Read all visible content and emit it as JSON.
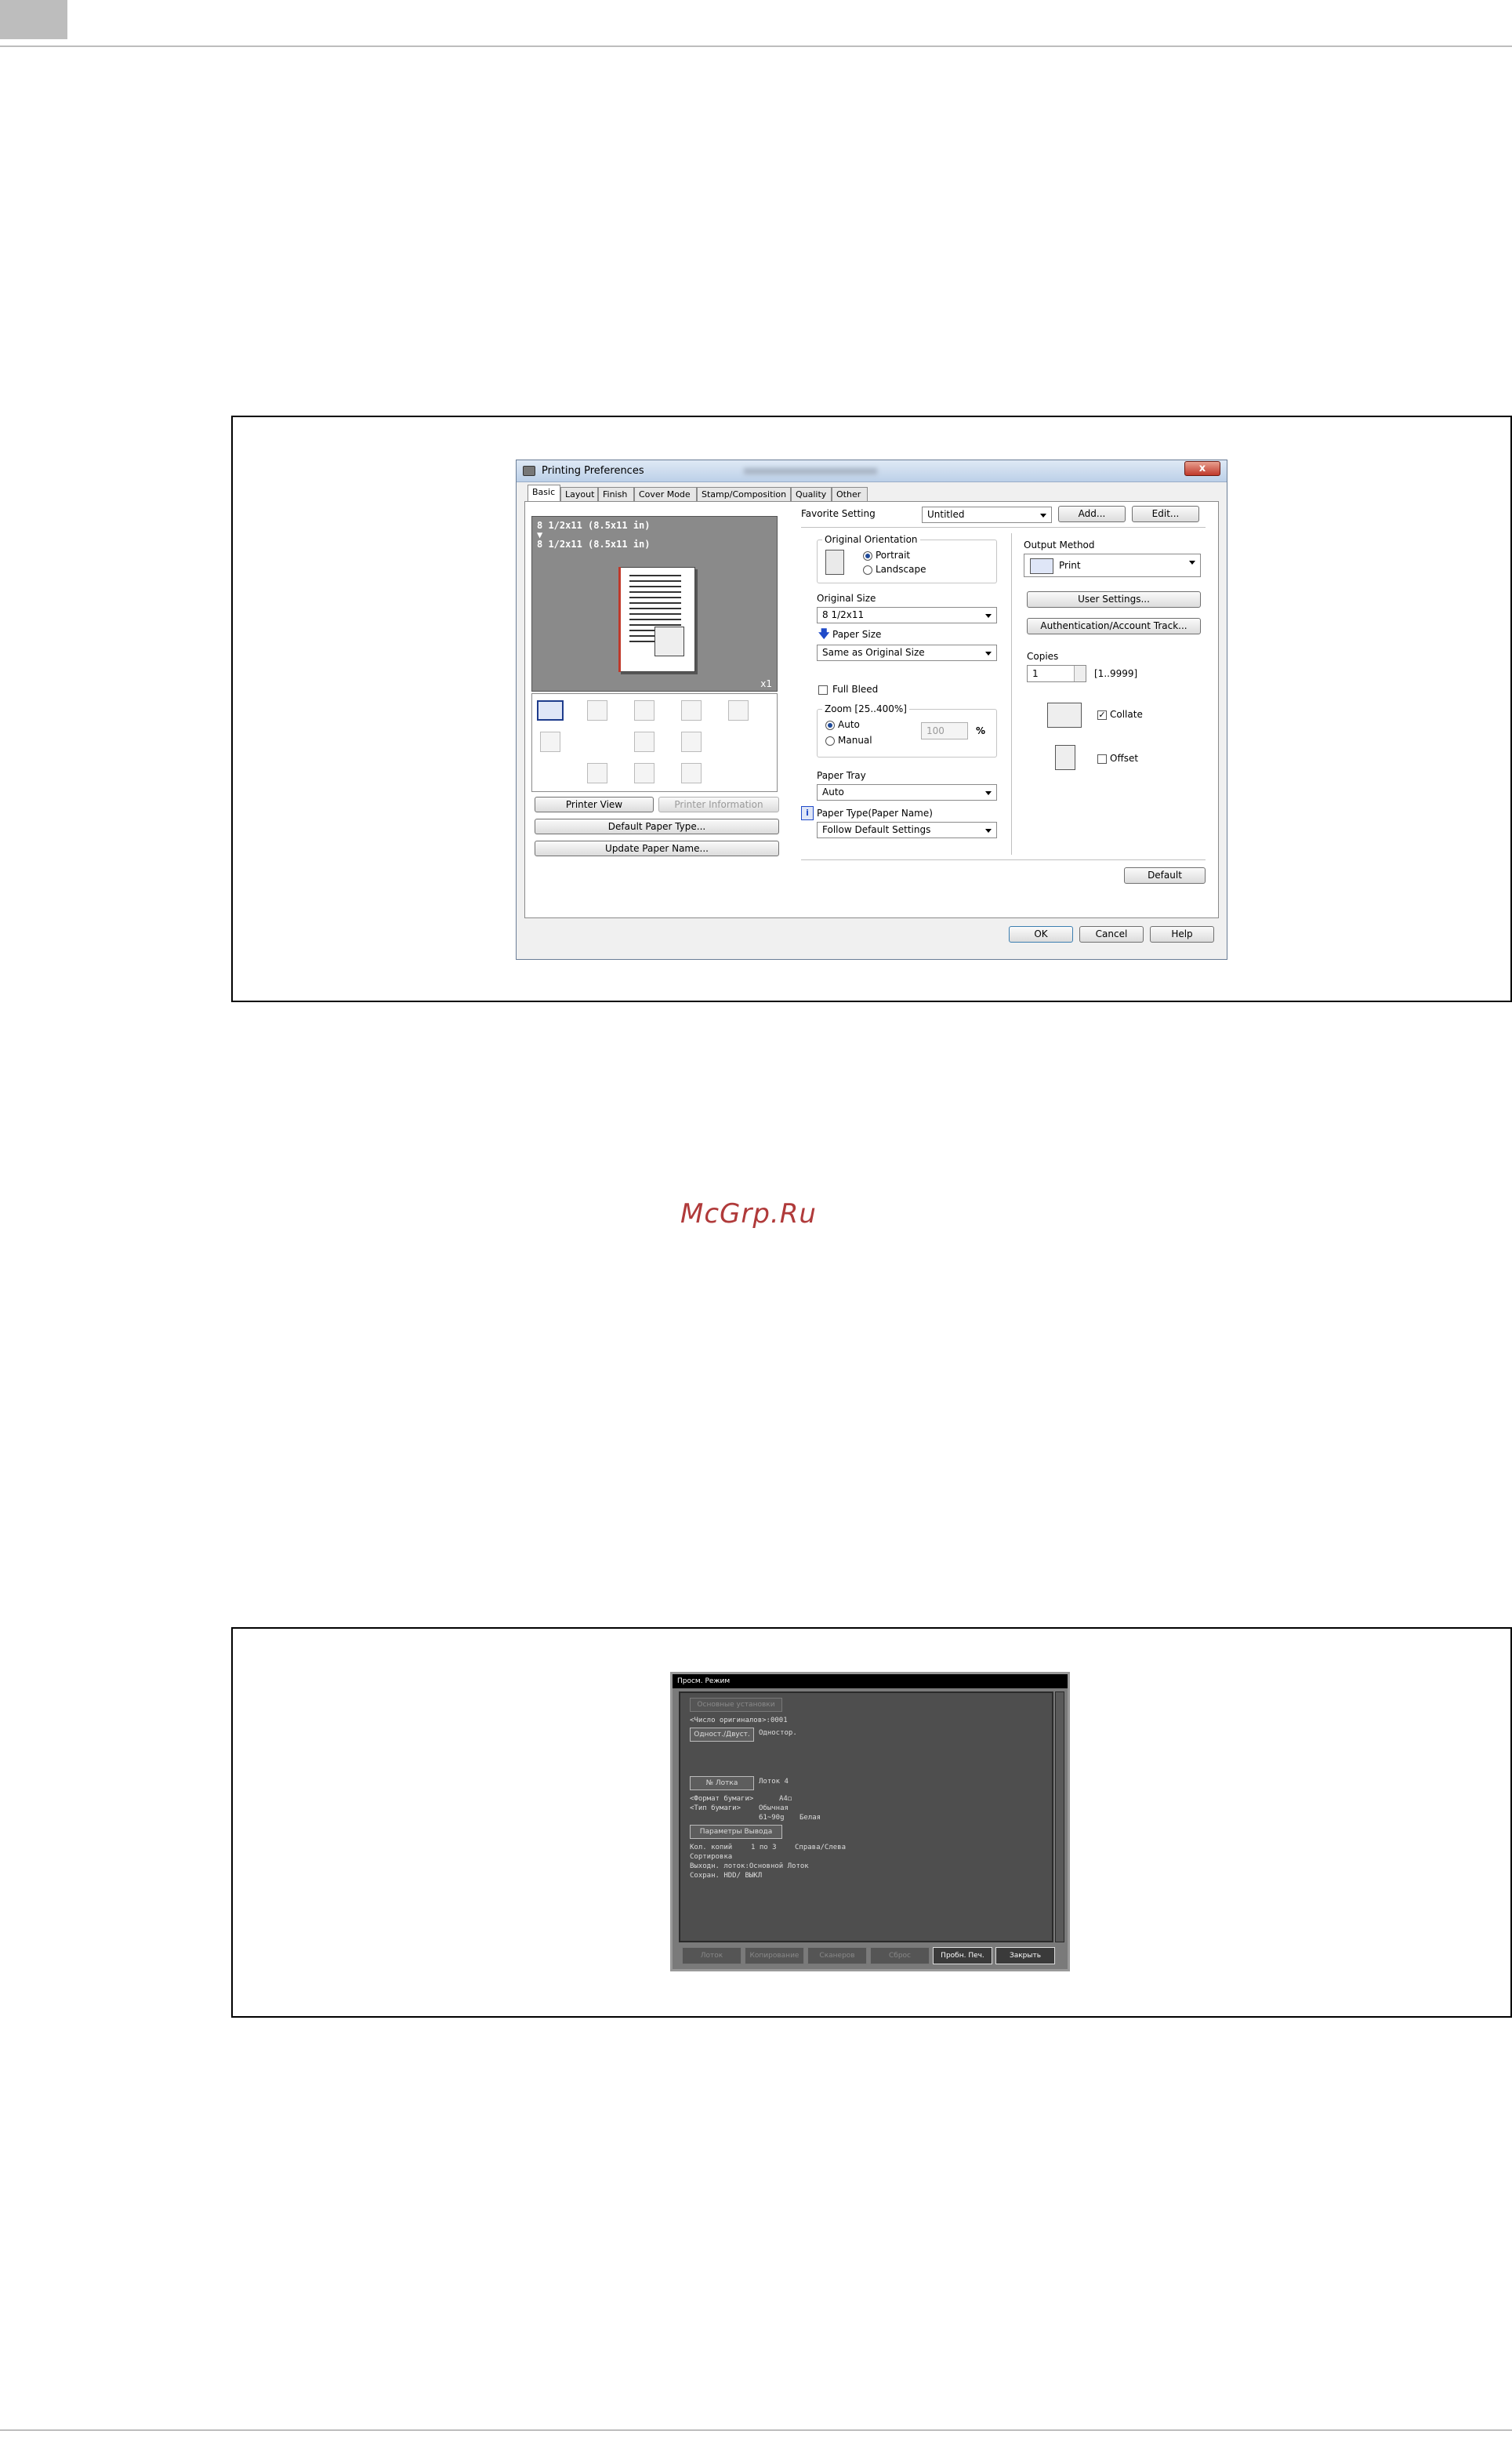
{
  "watermark": "McGrp.Ru",
  "dialog": {
    "title": "Printing Preferences",
    "close_label": "x",
    "tabs": [
      "Basic",
      "Layout",
      "Finish",
      "Cover Mode",
      "Stamp/Composition",
      "Quality",
      "Other"
    ],
    "active_tab": "Basic",
    "preview": {
      "line1": "8 1/2x11 (8.5x11 in)",
      "arrow": "▼",
      "line2": "8 1/2x11 (8.5x11 in)",
      "copies_badge": "x1"
    },
    "left_buttons": {
      "printer_view": "Printer View",
      "printer_information": "Printer Information",
      "default_paper_type": "Default Paper Type...",
      "update_paper_name": "Update Paper Name..."
    },
    "favorite": {
      "label": "Favorite Setting",
      "value": "Untitled",
      "add": "Add...",
      "edit": "Edit..."
    },
    "orientation": {
      "title": "Original Orientation",
      "portrait": "Portrait",
      "landscape": "Landscape",
      "selected": "Portrait"
    },
    "original_size": {
      "label": "Original Size",
      "value": "8 1/2x11"
    },
    "paper_size": {
      "label": "Paper Size",
      "value": "Same as Original Size"
    },
    "full_bleed": {
      "label": "Full Bleed",
      "checked": false
    },
    "zoom": {
      "title": "Zoom [25..400%]",
      "auto": "Auto",
      "manual": "Manual",
      "value": "100",
      "unit": "%",
      "selected": "Auto"
    },
    "paper_tray": {
      "label": "Paper Tray",
      "value": "Auto"
    },
    "paper_type": {
      "label": "Paper Type(Paper Name)",
      "value": "Follow Default Settings"
    },
    "output_method": {
      "label": "Output Method",
      "value": "Print"
    },
    "user_settings": "User Settings...",
    "authentication": "Authentication/Account Track...",
    "copies": {
      "label": "Copies",
      "value": "1",
      "range": "[1..9999]"
    },
    "collate": {
      "label": "Collate",
      "checked": true
    },
    "offset": {
      "label": "Offset",
      "checked": false
    },
    "default_button": "Default",
    "ok": "OK",
    "cancel": "Cancel",
    "help": "Help"
  },
  "panel": {
    "top_bar": "Просм. Режим",
    "basic_settings": "Основные установки",
    "copies_line": "<Число оригиналов>:0001",
    "sides_button": "Одност./Двуст.",
    "sides_value": "Одностор.",
    "tray_button": "№ Лотка",
    "tray_value": "Лоток 4",
    "paper_size_label": "<Формат бумаги>",
    "paper_size_value": "A4◻",
    "paper_type_label": "<Тип бумаги>",
    "paper_type_value": "Обычная",
    "weight_value": "61~90g",
    "color_value": "Белая",
    "output_button": "Параметры Вывода",
    "output_copies_label": "Кол. копий",
    "output_copies_value": "1 по 3",
    "output_dir": "Справа/Слева",
    "sort_label": "Сортировка",
    "exit_tray": "Выходн. лоток:Основной Лоток",
    "save": "Сохран. HDD/ ВЫКЛ",
    "footer": [
      "Лоток",
      "Копирование",
      "Сканеров",
      "Сброс",
      "Пробн. Печ.",
      "Закрыть"
    ]
  }
}
